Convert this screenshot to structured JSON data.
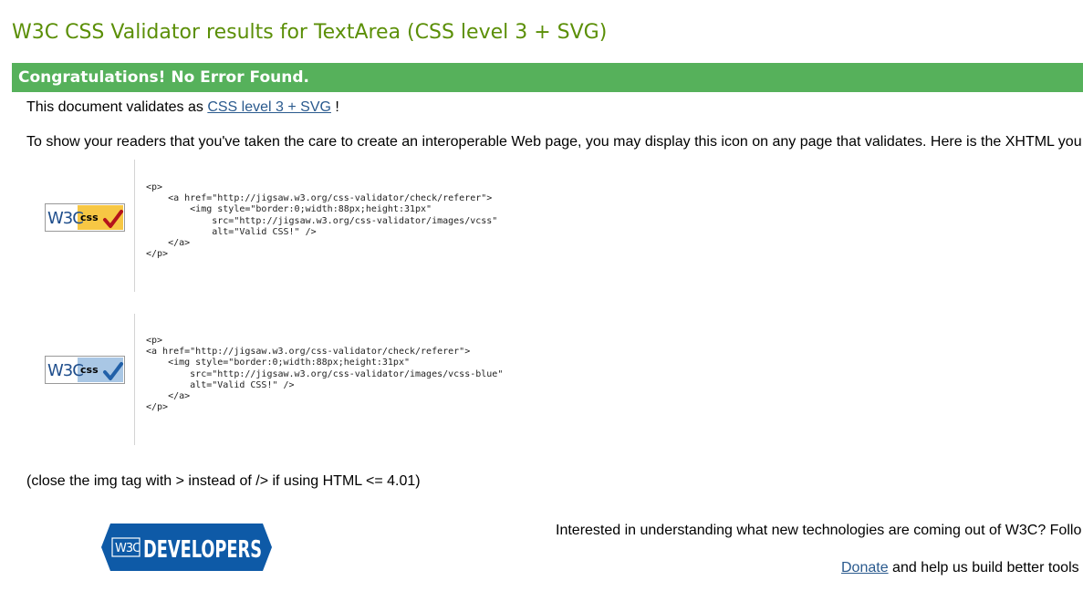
{
  "header": {
    "title": "W3C CSS Validator results for TextArea (CSS level 3 + SVG)"
  },
  "banner": {
    "text": "Congratulations! No Error Found."
  },
  "validates": {
    "prefix": "This document validates as",
    "link_text": "CSS level 3 + SVG",
    "suffix": "!"
  },
  "readers_text": "To show your readers that you've taken the care to create an interoperable Web page, you may display this icon on any page that validates. Here is the XHTML you",
  "badges": [
    {
      "name": "vcss",
      "logo_w3c": "W3C",
      "logo_css": "css",
      "code": "<p>\n    <a href=\"http://jigsaw.w3.org/css-validator/check/referer\">\n        <img style=\"border:0;width:88px;height:31px\"\n            src=\"http://jigsaw.w3.org/css-validator/images/vcss\"\n            alt=\"Valid CSS!\" />\n    </a>\n</p>"
    },
    {
      "name": "vcss-blue",
      "logo_w3c": "W3C",
      "logo_css": "css",
      "code": "<p>\n<a href=\"http://jigsaw.w3.org/css-validator/check/referer\">\n    <img style=\"border:0;width:88px;height:31px\"\n        src=\"http://jigsaw.w3.org/css-validator/images/vcss-blue\"\n        alt=\"Valid CSS!\" />\n    </a>\n</p>"
    }
  ],
  "close_note": "(close the img tag with > instead of /> if using HTML <= 4.01)",
  "footer": {
    "logo_w3c": "W3C",
    "logo_text": "DEVELOPERS",
    "interested_text": "Interested in understanding what new technologies are coming out of W3C? Follo",
    "donate_link": "Donate",
    "donate_text": "and help us build better tools"
  },
  "colors": {
    "title": "#5b8f07",
    "banner": "#56b15b",
    "link": "#2a5a8e",
    "badge_gold": "#f7c744",
    "badge_blue": "#a9c7e5",
    "check_red": "#b5121b",
    "check_blue": "#2160a8",
    "developers_blue": "#0e5aa7"
  }
}
